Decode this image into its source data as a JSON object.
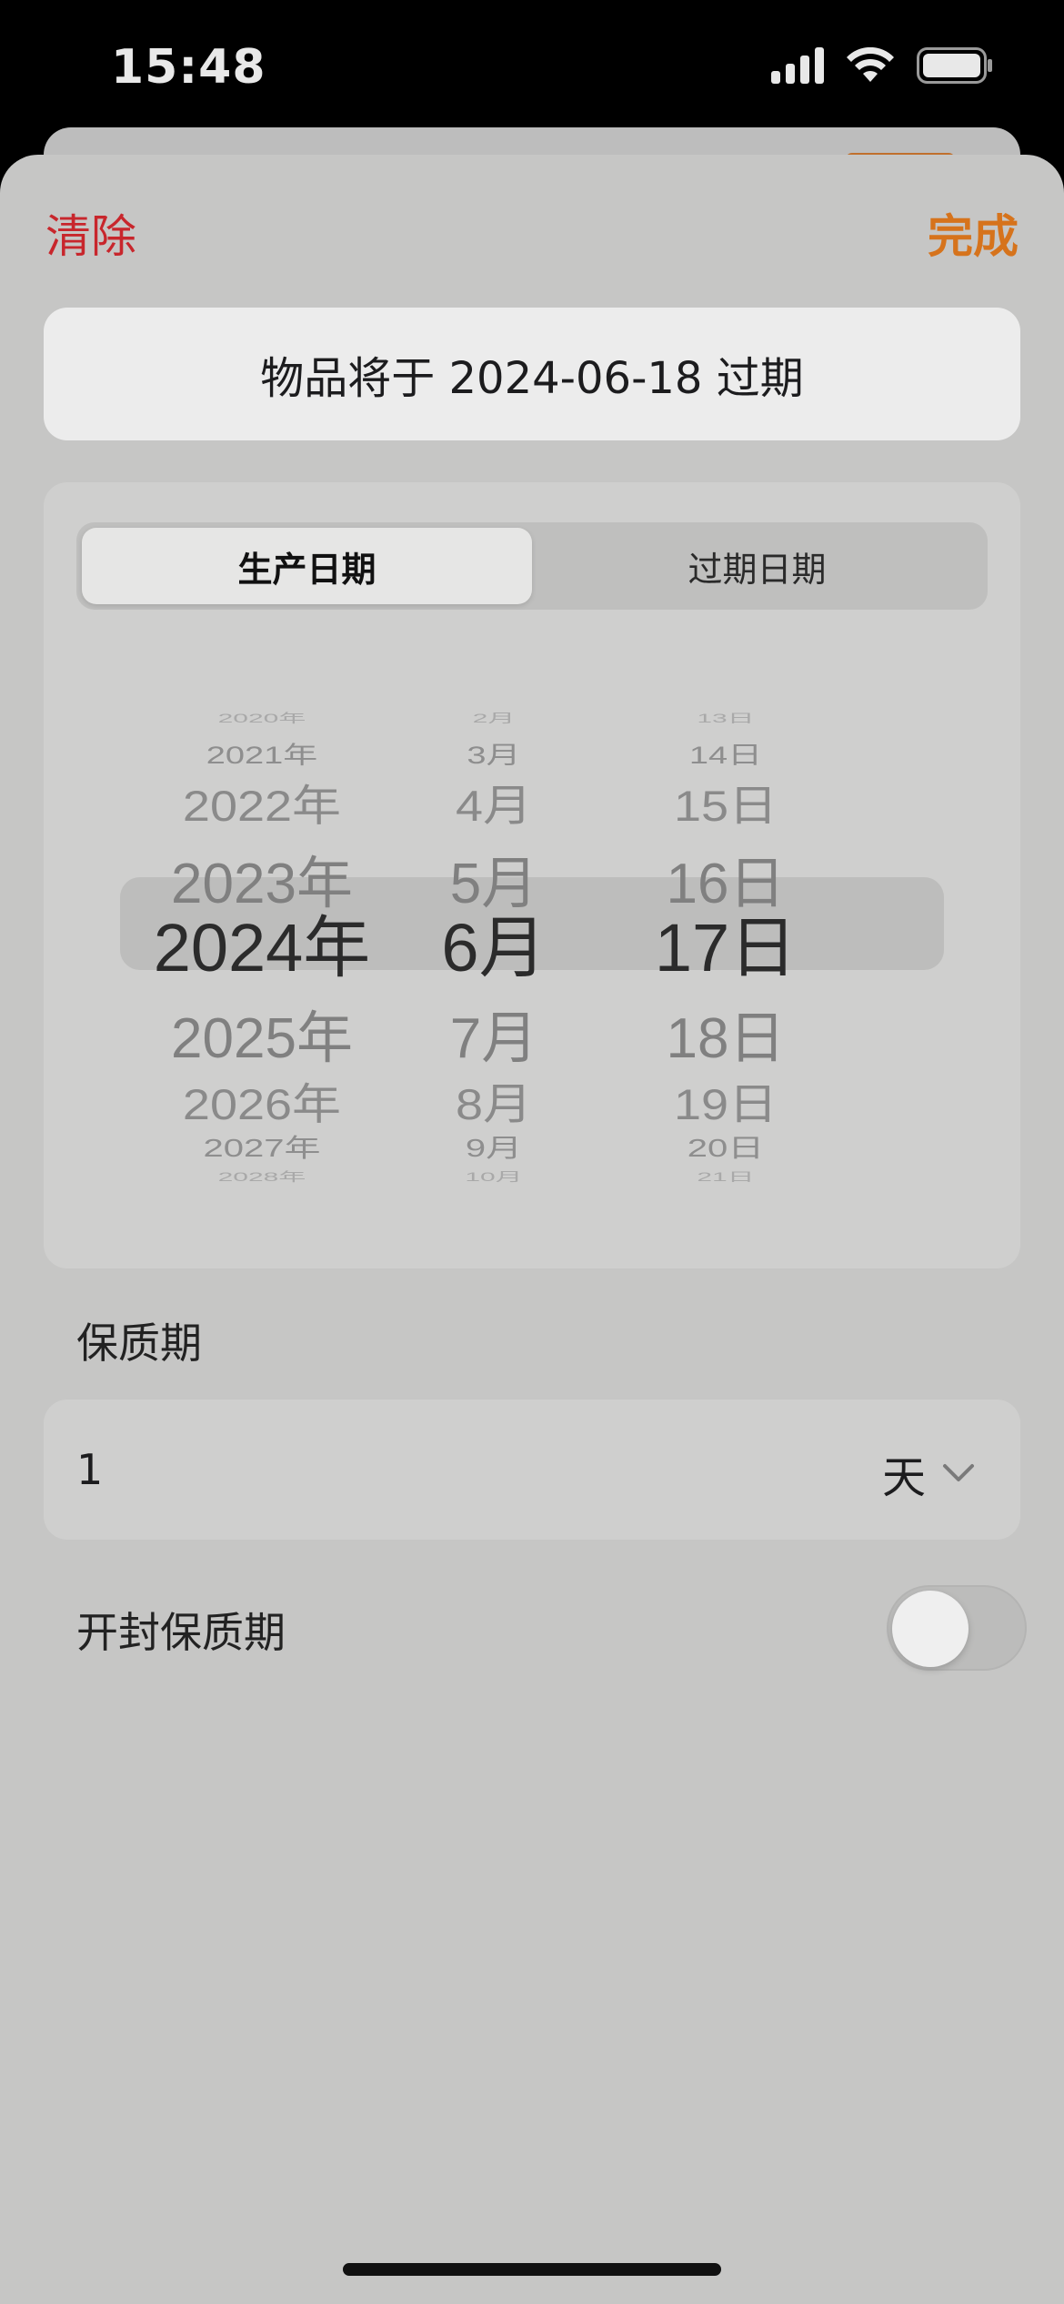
{
  "status_bar": {
    "time": "15:48",
    "icons": [
      "cellular-signal-icon",
      "wifi-icon",
      "battery-icon"
    ]
  },
  "sheet": {
    "clear_label": "清除",
    "done_label": "完成",
    "expiry_message": "物品将于 2024-06-18 过期",
    "segmented": {
      "options": [
        "生产日期",
        "过期日期"
      ],
      "selected": "生产日期"
    },
    "picker": {
      "years": [
        "2020年",
        "2021年",
        "2022年",
        "2023年",
        "2024年",
        "2025年",
        "2026年",
        "2027年",
        "2028年"
      ],
      "months": [
        "2月",
        "3月",
        "4月",
        "5月",
        "6月",
        "7月",
        "8月",
        "9月",
        "10月"
      ],
      "days": [
        "13日",
        "14日",
        "15日",
        "16日",
        "17日",
        "18日",
        "19日",
        "20日",
        "21日"
      ],
      "selected": {
        "year": "2024年",
        "month": "6月",
        "day": "17日"
      }
    },
    "shelf_life": {
      "label": "保质期",
      "value": "1",
      "unit": "天"
    },
    "opened_shelf_life": {
      "label": "开封保质期",
      "enabled": false
    }
  },
  "colors": {
    "clear": "#c8262c",
    "done": "#d6731c",
    "sheet_bg": "#c6c6c5"
  }
}
